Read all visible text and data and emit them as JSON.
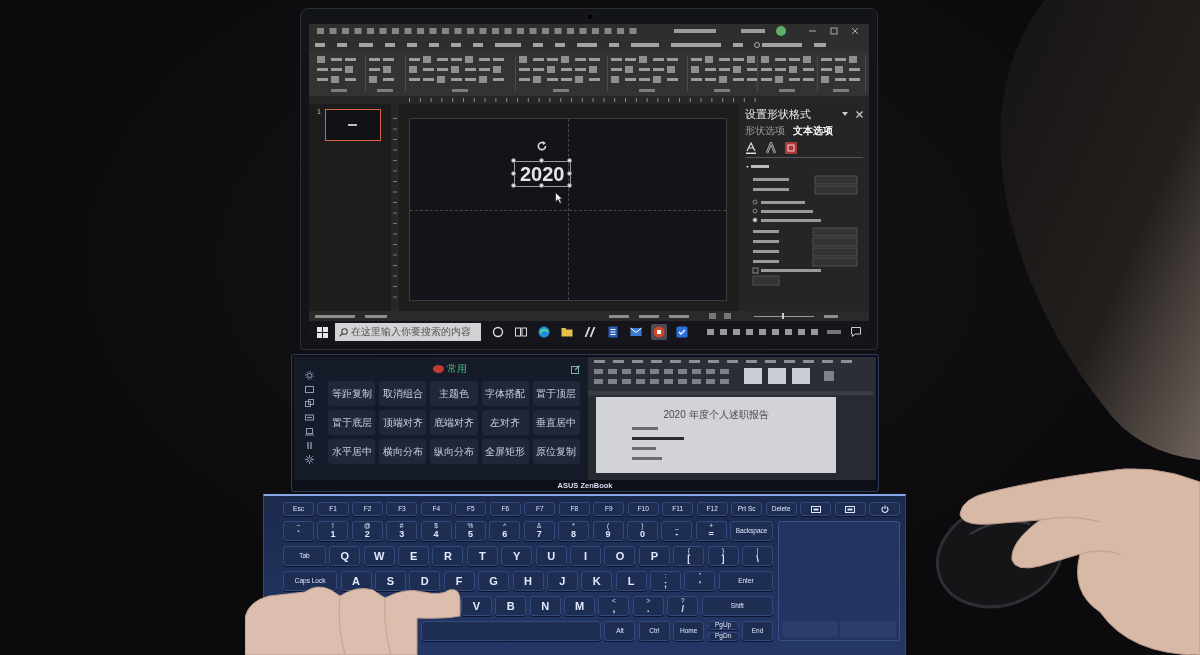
{
  "laptop_screen": {
    "slide_number": "1",
    "slide_text": "2020",
    "format_panel": {
      "title": "设置形状格式",
      "tabs": [
        {
          "label": "形状选项",
          "selected": false
        },
        {
          "label": "文本选项",
          "selected": true
        }
      ]
    },
    "taskbar": {
      "search_placeholder": "在这里输入你要搜索的内容",
      "apps": [
        {
          "kind": "ring",
          "selected": false
        },
        {
          "kind": "task-view",
          "selected": false
        },
        {
          "kind": "browser",
          "selected": false
        },
        {
          "kind": "folder",
          "selected": false
        },
        {
          "kind": "slashes",
          "selected": false
        },
        {
          "kind": "document",
          "selected": false
        },
        {
          "kind": "mail",
          "selected": false
        },
        {
          "kind": "presentation",
          "selected": true
        },
        {
          "kind": "check-app",
          "selected": false
        }
      ]
    }
  },
  "screenpad": {
    "group_label": "常用",
    "buttons": [
      "等距复制",
      "取消组合",
      "主题色",
      "字体搭配",
      "置于顶层",
      "置于底层",
      "顶端对齐",
      "底端对齐",
      "左对齐",
      "垂直居中",
      "水平居中",
      "横向分布",
      "纵向分布",
      "全屏矩形",
      "原位复制"
    ],
    "document_title": "2020 年度个人述职报告",
    "brand": "ASUS ZenBook"
  },
  "keyboard": {
    "rows": [
      {
        "kind": "function",
        "keys": [
          {
            "kind": "key",
            "label": "Esc"
          },
          {
            "kind": "key",
            "label": "F1"
          },
          {
            "kind": "key",
            "label": "F2"
          },
          {
            "kind": "key",
            "label": "F3"
          },
          {
            "kind": "key",
            "label": "F4"
          },
          {
            "kind": "key",
            "label": "F5"
          },
          {
            "kind": "key",
            "label": "F6"
          },
          {
            "kind": "key",
            "label": "F7"
          },
          {
            "kind": "key",
            "label": "F8"
          },
          {
            "kind": "key",
            "label": "F9"
          },
          {
            "kind": "key",
            "label": "F10"
          },
          {
            "kind": "key",
            "label": "F11"
          },
          {
            "kind": "key",
            "label": "F12"
          },
          {
            "kind": "key",
            "label": "Prt Sc"
          },
          {
            "kind": "key",
            "label": "Delete"
          },
          {
            "kind": "screen"
          },
          {
            "kind": "screen"
          },
          {
            "kind": "power"
          }
        ]
      },
      {
        "kind": "main",
        "keys": [
          {
            "kind": "key",
            "top": "~",
            "label": "`"
          },
          {
            "kind": "key",
            "top": "!",
            "label": "1"
          },
          {
            "kind": "key",
            "top": "@",
            "label": "2"
          },
          {
            "kind": "key",
            "top": "#",
            "label": "3"
          },
          {
            "kind": "key",
            "top": "$",
            "label": "4"
          },
          {
            "kind": "key",
            "top": "%",
            "label": "5"
          },
          {
            "kind": "key",
            "top": "^",
            "label": "6"
          },
          {
            "kind": "key",
            "top": "&",
            "label": "7"
          },
          {
            "kind": "key",
            "top": "*",
            "label": "8"
          },
          {
            "kind": "key",
            "top": "(",
            "label": "9"
          },
          {
            "kind": "key",
            "top": ")",
            "label": "0"
          },
          {
            "kind": "key",
            "top": "_",
            "label": "-"
          },
          {
            "kind": "key",
            "top": "+",
            "label": "="
          },
          {
            "kind": "wide",
            "label": "Backspace"
          }
        ]
      },
      {
        "kind": "main",
        "keys": [
          {
            "kind": "wide",
            "label": "Tab"
          },
          {
            "kind": "key",
            "label": "Q"
          },
          {
            "kind": "key",
            "label": "W"
          },
          {
            "kind": "key",
            "label": "E"
          },
          {
            "kind": "key",
            "label": "R"
          },
          {
            "kind": "key",
            "label": "T"
          },
          {
            "kind": "key",
            "label": "Y"
          },
          {
            "kind": "key",
            "label": "U"
          },
          {
            "kind": "key",
            "label": "I"
          },
          {
            "kind": "key",
            "label": "O"
          },
          {
            "kind": "key",
            "label": "P"
          },
          {
            "kind": "key",
            "top": "{",
            "label": "["
          },
          {
            "kind": "key",
            "top": "}",
            "label": "]"
          },
          {
            "kind": "key",
            "top": "|",
            "label": "\\"
          }
        ]
      },
      {
        "kind": "main",
        "keys": [
          {
            "kind": "wide",
            "label": "Caps Lock"
          },
          {
            "kind": "key",
            "label": "A"
          },
          {
            "kind": "key",
            "label": "S"
          },
          {
            "kind": "key",
            "label": "D"
          },
          {
            "kind": "key",
            "label": "F"
          },
          {
            "kind": "key",
            "label": "G"
          },
          {
            "kind": "key",
            "label": "H"
          },
          {
            "kind": "key",
            "label": "J"
          },
          {
            "kind": "key",
            "label": "K"
          },
          {
            "kind": "key",
            "label": "L"
          },
          {
            "kind": "key",
            "top": ":",
            "label": ";"
          },
          {
            "kind": "key",
            "top": "\"",
            "label": "'"
          },
          {
            "kind": "wide",
            "label": "Enter"
          }
        ]
      },
      {
        "kind": "main",
        "keys": [
          {
            "kind": "wide"
          },
          {
            "kind": "key"
          },
          {
            "kind": "key"
          },
          {
            "kind": "key"
          },
          {
            "kind": "key",
            "label": "V"
          },
          {
            "kind": "key",
            "label": "B"
          },
          {
            "kind": "key",
            "label": "N"
          },
          {
            "kind": "key",
            "label": "M"
          },
          {
            "kind": "key",
            "top": "<",
            "label": ","
          },
          {
            "kind": "key",
            "top": ">",
            "label": "."
          },
          {
            "kind": "key",
            "top": "?",
            "label": "/"
          },
          {
            "kind": "wide",
            "label": "Shift"
          }
        ]
      },
      {
        "kind": "main",
        "keys": [
          {
            "kind": "key"
          },
          {
            "kind": "key"
          },
          {
            "kind": "key"
          },
          {
            "kind": "key"
          },
          {
            "kind": "space"
          },
          {
            "kind": "key",
            "label": "Alt"
          },
          {
            "kind": "key",
            "label": "Ctrl"
          },
          {
            "kind": "key",
            "label": "Home"
          },
          {
            "kind": "pair",
            "top": "PgUp",
            "label": "PgDn"
          },
          {
            "kind": "key",
            "label": "End"
          }
        ]
      }
    ]
  }
}
